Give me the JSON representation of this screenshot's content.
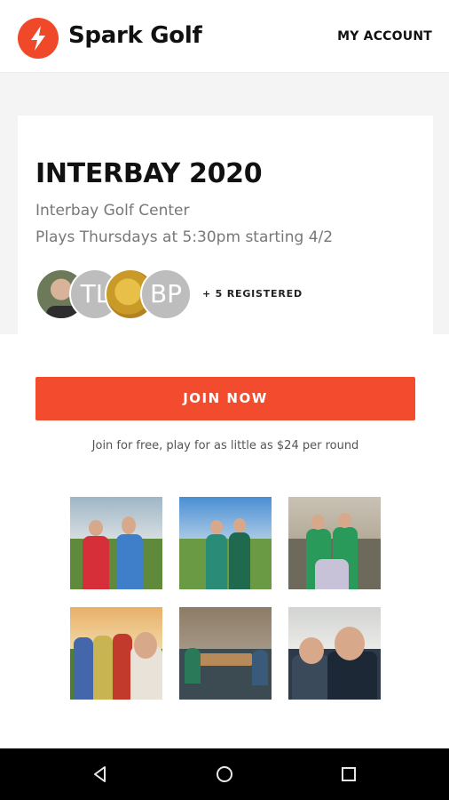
{
  "header": {
    "brand": "Spark Golf",
    "account_link": "MY ACCOUNT"
  },
  "league": {
    "title": "INTERBAY 2020",
    "venue": "Interbay Golf Center",
    "schedule": "Plays Thursdays at 5:30pm starting 4/2"
  },
  "participants": {
    "avatars": [
      {
        "type": "photo"
      },
      {
        "type": "initials",
        "initials": "TL"
      },
      {
        "type": "photo"
      },
      {
        "type": "initials",
        "initials": "BP"
      }
    ],
    "registered_text": "+ 5 REGISTERED"
  },
  "cta": {
    "join_label": "JOIN NOW",
    "tagline": "Join for free, play for as little as $24 per round"
  },
  "gallery": {
    "photo_count": 6
  },
  "colors": {
    "accent": "#f24b2e",
    "brand_icon": "#f0492a"
  },
  "navbar": {
    "icons": [
      "back-icon",
      "home-icon",
      "recents-icon"
    ]
  }
}
